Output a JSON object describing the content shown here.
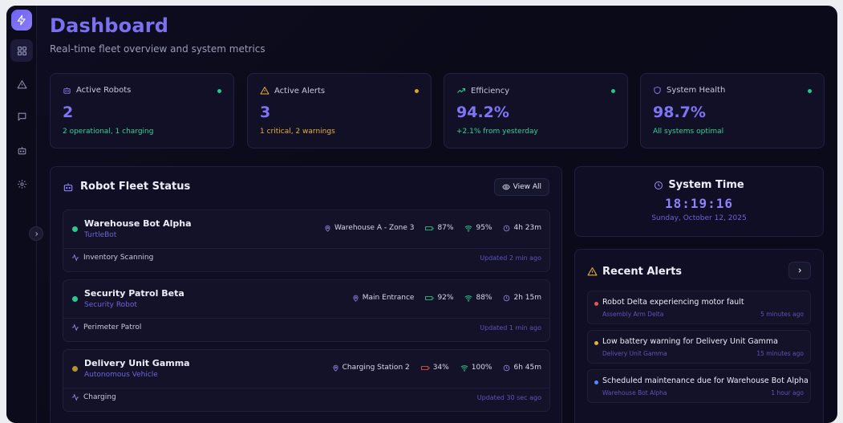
{
  "header": {
    "title": "Dashboard",
    "subtitle": "Real-time fleet overview and system metrics"
  },
  "stats": [
    {
      "label": "Active Robots",
      "value": "2",
      "sub": "2 operational, 1 charging",
      "icon": "robot-icon",
      "dot_color": "#22c98b",
      "sub_color": "#2fd493"
    },
    {
      "label": "Active Alerts",
      "value": "3",
      "sub": "1 critical, 2 warnings",
      "icon": "alert-triangle-icon",
      "dot_color": "#d9a42a",
      "sub_color": "#e5b233"
    },
    {
      "label": "Efficiency",
      "value": "94.2%",
      "sub": "+2.1% from yesterday",
      "icon": "trending-up-icon",
      "dot_color": "#22c98b",
      "sub_color": "#2fd493"
    },
    {
      "label": "System Health",
      "value": "98.7%",
      "sub": "All systems optimal",
      "icon": "shield-icon",
      "dot_color": "#22c98b",
      "sub_color": "#2fd493"
    }
  ],
  "fleet": {
    "title": "Robot Fleet Status",
    "view_all": "View All",
    "robots": [
      {
        "name": "Warehouse Bot Alpha",
        "type": "TurtleBot",
        "status_color": "#27c98c",
        "location": "Warehouse A - Zone 3",
        "battery": "87%",
        "battery_color": "#2fd493",
        "signal": "95%",
        "uptime": "4h 23m",
        "task": "Inventory Scanning",
        "updated": "Updated 2 min ago"
      },
      {
        "name": "Security Patrol Beta",
        "type": "Security Robot",
        "status_color": "#27c98c",
        "location": "Main Entrance",
        "battery": "92%",
        "battery_color": "#2fd493",
        "signal": "88%",
        "uptime": "2h 15m",
        "task": "Perimeter Patrol",
        "updated": "Updated 1 min ago"
      },
      {
        "name": "Delivery Unit Gamma",
        "type": "Autonomous Vehicle",
        "status_color": "#b8902c",
        "location": "Charging Station 2",
        "battery": "34%",
        "battery_color": "#f0604a",
        "signal": "100%",
        "uptime": "6h 45m",
        "task": "Charging",
        "updated": "Updated 30 sec ago"
      }
    ]
  },
  "clock": {
    "title": "System Time",
    "time": "18:19:16",
    "date": "Sunday, October 12, 2025"
  },
  "alerts": {
    "title": "Recent Alerts",
    "items": [
      {
        "text": "Robot Delta experiencing motor fault",
        "source": "Assembly Arm Delta",
        "time": "5 minutes ago",
        "color": "#f05252"
      },
      {
        "text": "Low battery warning for Delivery Unit Gamma",
        "source": "Delivery Unit Gamma",
        "time": "15 minutes ago",
        "color": "#e5b233"
      },
      {
        "text": "Scheduled maintenance due for Warehouse Bot Alpha",
        "source": "Warehouse Bot Alpha",
        "time": "1 hour ago",
        "color": "#4f8cf7"
      }
    ]
  },
  "theme": {
    "accent": "#7b70f0",
    "success": "#2fd493",
    "warning": "#e5b233",
    "danger": "#f05252"
  }
}
